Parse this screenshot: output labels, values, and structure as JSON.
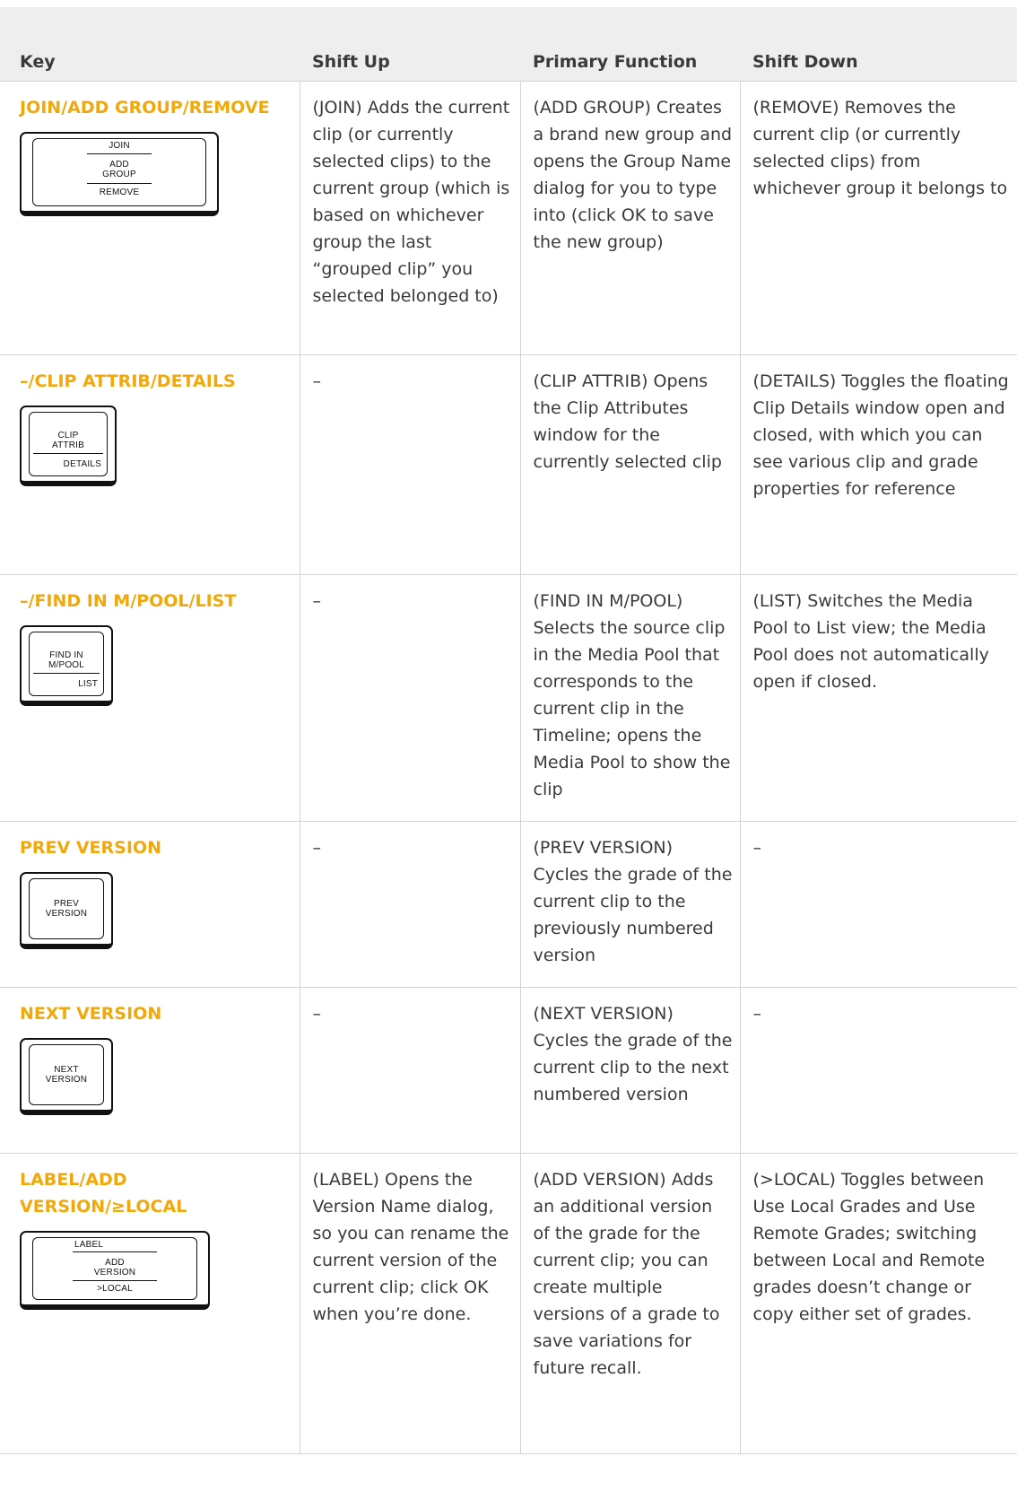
{
  "header": {
    "key": "Key",
    "shift_up": "Shift Up",
    "primary": "Primary Function",
    "shift_down": "Shift Down"
  },
  "rows": [
    {
      "key": "JOIN/ADD GROUP/REMOVE",
      "keycap": {
        "top": "JOIN",
        "middle1": "ADD",
        "middle2": "GROUP",
        "bottom": "REMOVE"
      },
      "shift_up": "(JOIN) Adds the current clip (or currently selected clips) to the current group (which is based on whichever group the last “grouped clip” you selected belonged to)",
      "primary": "(ADD GROUP) Creates a brand new group and opens the Group Name dialog for you to type into (click OK to save the new group)",
      "shift_down": "(REMOVE) Removes the current clip (or currently selected clips) from whichever group it belongs to"
    },
    {
      "key": "–/CLIP ATTRIB/DETAILS",
      "keycap": {
        "middle1": "CLIP",
        "middle2": "ATTRIB",
        "bottom": "DETAILS"
      },
      "shift_up": "–",
      "primary": "(CLIP ATTRIB) Opens the Clip Attributes window for the currently selected clip",
      "shift_down": "(DETAILS) Toggles the floating Clip Details window open and closed, with which you can see various clip and grade properties for reference"
    },
    {
      "key": "–/FIND IN M/POOL/LIST",
      "keycap": {
        "middle1": "FIND IN",
        "middle2": "M/POOL",
        "bottom": "LIST"
      },
      "shift_up": "–",
      "primary": "(FIND IN M/POOL) Selects the source clip in the Media Pool that corresponds to the current clip in the Timeline; opens the Media Pool to show the clip",
      "shift_down": "(LIST) Switches the Media Pool to List view; the Media Pool does not automatically open if closed."
    },
    {
      "key": "PREV VERSION",
      "keycap": {
        "middle1": "PREV",
        "middle2": "VERSION"
      },
      "shift_up": "–",
      "primary": "(PREV VERSION) Cycles the grade of the current clip to the previously numbered version",
      "shift_down": "–"
    },
    {
      "key": "NEXT VERSION",
      "keycap": {
        "middle1": "NEXT",
        "middle2": "VERSION"
      },
      "shift_up": "–",
      "primary": "(NEXT VERSION) Cycles the grade of the current clip to the next numbered version",
      "shift_down": "–"
    },
    {
      "key": "LABEL/ADD VERSION/≥LOCAL",
      "keycap": {
        "top": "LABEL",
        "middle1": "ADD",
        "middle2": "VERSION",
        "bottom": ">LOCAL"
      },
      "shift_up": "(LABEL) Opens the Version Name dialog, so you can rename the current version of the current clip; click OK when you’re done.",
      "primary": "(ADD VERSION) Adds an additional version of the grade for the current clip; you can create multiple versions of a grade to save variations for future recall.",
      "shift_down": "(>LOCAL) Toggles between Use Local Grades and Use Remote Grades; switching between Local and Remote grades doesn’t change or copy either set of grades."
    }
  ]
}
